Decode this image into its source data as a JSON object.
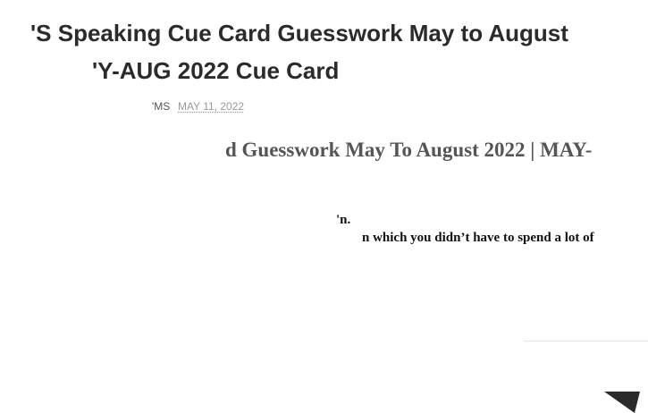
{
  "post": {
    "title_line1": "'S Speaking Cue Card Guesswork May to August",
    "title_line2": "'Y-AUG 2022 Cue Card",
    "author_fragment": "'MS",
    "date": "MAY 11, 2022"
  },
  "content": {
    "subheading": "d Guesswork May To August 2022 | MAY-",
    "line1": "'n.",
    "line2": "n which you didn’t have to spend a lot of"
  },
  "icons": {
    "corner": "triangle-arrow-icon"
  },
  "colors": {
    "title": "#2b2b2b",
    "date": "#9a9a9a",
    "subheading": "#555555",
    "icon": "#2b2b2b"
  }
}
